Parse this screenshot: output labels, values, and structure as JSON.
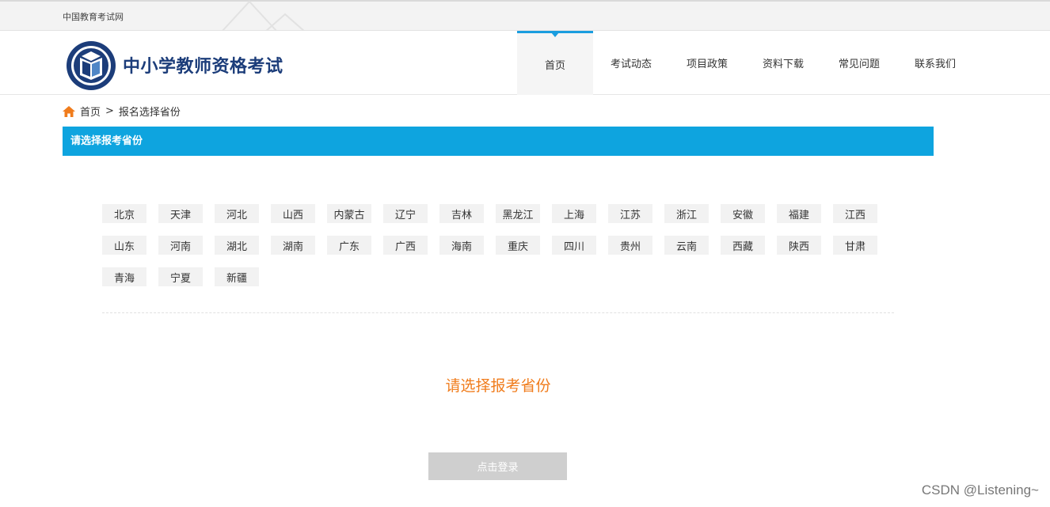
{
  "topbar": {
    "site_name": "中国教育考试网"
  },
  "header": {
    "brand": "中小学教师资格考试",
    "nav": [
      "首页",
      "考试动态",
      "项目政策",
      "资料下载",
      "常见问题",
      "联系我们"
    ],
    "active_index": 0
  },
  "breadcrumb": {
    "home": "首页",
    "separator": ">",
    "current": "报名选择省份"
  },
  "panel": {
    "title": "请选择报考省份"
  },
  "provinces": [
    "北京",
    "天津",
    "河北",
    "山西",
    "内蒙古",
    "辽宁",
    "吉林",
    "黑龙江",
    "上海",
    "江苏",
    "浙江",
    "安徽",
    "福建",
    "江西",
    "山东",
    "河南",
    "湖北",
    "湖南",
    "广东",
    "广西",
    "海南",
    "重庆",
    "四川",
    "贵州",
    "云南",
    "西藏",
    "陕西",
    "甘肃",
    "青海",
    "宁夏",
    "新疆"
  ],
  "prompt": "请选择报考省份",
  "login_button": "点击登录",
  "watermark": "CSDN @Listening~",
  "colors": {
    "accent": "#0ea4df",
    "prompt": "#f07c1c",
    "brand": "#1c3d7a",
    "button_disabled": "#cfcfcf"
  }
}
